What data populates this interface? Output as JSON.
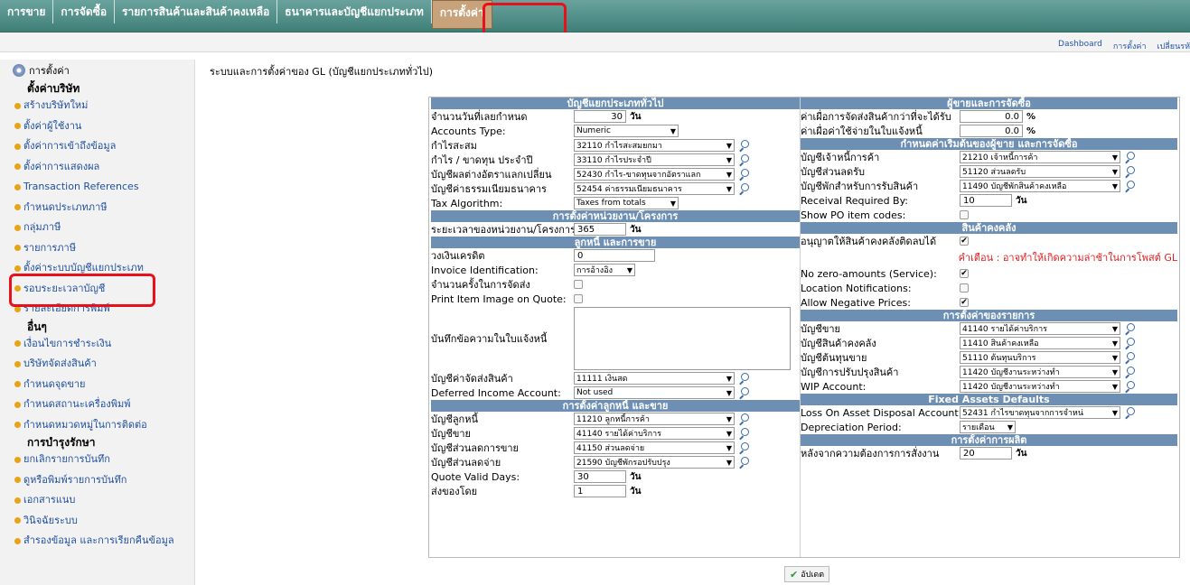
{
  "topnav": {
    "tabs": [
      "การขาย",
      "การจัดซื้อ",
      "รายการสินค้าและสินค้าคงเหลือ",
      "ธนาคารและบัญชีแยกประเภท",
      "การตั้งค่า"
    ],
    "links": [
      "Dashboard",
      "การตั้งค่า",
      "เปลี่ยนรหั"
    ]
  },
  "sidebar": {
    "header": "การตั้งค่า",
    "sections": [
      {
        "title": "ตั้งค่าบริษัท",
        "items": [
          "สร้างบริษัทใหม่",
          "ตั้งค่าผู้ใช้งาน",
          "ตั้งค่าการเข้าถึงข้อมูล",
          "ตั้งค่าการแสดงผล",
          "Transaction References",
          "กำหนดประเภทภาษี",
          "กลุ่มภาษี",
          "รายการภาษี",
          "ตั้งค่าระบบบัญชีแยกประเภท",
          "รอบระยะเวลาบัญชี",
          "รายละเอียดการพิมพ์"
        ]
      },
      {
        "title": "อื่นๆ",
        "items": [
          "เงื่อนไขการชำระเงิน",
          "บริษัทจัดส่งสินค้า",
          "กำหนดจุดขาย",
          "กำหนดสถานะเครื่องพิมพ์",
          "กำหนดหมวดหมู่ในการติดต่อ"
        ]
      },
      {
        "title": "การบำรุงรักษา",
        "items": [
          "ยกเลิกรายการบันทึก",
          "ดูหรือพิมพ์รายการบันทึก",
          "เอกสารแนบ",
          "วินิจฉัยระบบ",
          "สำรองข้อมูล และการเรียกคืนข้อมูล"
        ]
      }
    ]
  },
  "page": {
    "title": "ระบบและการตั้งค่าของ GL (บัญชีแยกประเภททั่วไป)",
    "update_label": "อัปเดต"
  },
  "left": {
    "gl": {
      "heading": "บัญชีแยกประเภททั่วไป",
      "rows": [
        {
          "label": "จำนวนวันที่เลยกำหนด",
          "value": "30",
          "unit": "วัน"
        },
        {
          "label": "Accounts Type:",
          "value": "Numeric"
        },
        {
          "label": "กำไรสะสม",
          "value": "32110   กำไรสะสมยกมา"
        },
        {
          "label": "กำไร / ขาดทุน ประจำปี",
          "value": "33110   กำไรประจำปี"
        },
        {
          "label": "บัญชีผลต่างอัตราแลกเปลี่ยน",
          "value": "52430   กำไร-ขาดทุนจากอัตราแลก"
        },
        {
          "label": "บัญชีค่าธรรมเนียมธนาคาร",
          "value": "52454   ค่าธรรมเนียมธนาคาร"
        },
        {
          "label": "Tax Algorithm:",
          "value": "Taxes from totals"
        }
      ]
    },
    "dim": {
      "heading": "การตั้งค่าหน่วยงาน/โครงการ",
      "label": "ระยะเวลาของหน่วยงาน/โครงการ",
      "value": "365",
      "unit": "วัน"
    },
    "cust": {
      "heading": "ลูกหนี้ และการขาย",
      "credit_label": "วงเงินเครดิต",
      "credit_value": "0",
      "invoice_label": "Invoice Identification:",
      "invoice_value": "การอ้างอิง",
      "ship_label": "จำนวนครั้งในการจัดส่ง",
      "print_label": "Print Item Image on Quote:",
      "memo_label": "บันทึกข้อความในใบแจ้งหนี้",
      "freight_label": "บัญชีค่าจัดส่งสินค้า",
      "freight_value": "11111   เงินสด",
      "deferred_label": "Deferred Income Account:",
      "deferred_value": "Not used"
    },
    "custdef": {
      "heading": "การตั้งค่าลูกหนี้ และขาย",
      "rows": [
        {
          "label": "บัญชีลูกหนี้",
          "value": "11210   ลูกหนี้การค้า"
        },
        {
          "label": "บัญชีขาย",
          "value": "41140   รายได้ค่าบริการ"
        },
        {
          "label": "บัญชีส่วนลดการขาย",
          "value": "41150   ส่วนลดจ่าย"
        },
        {
          "label": "บัญชีส่วนลดจ่าย",
          "value": "21590   บัญชีพักรอปรับปรุง"
        }
      ],
      "quote_label": "Quote Valid Days:",
      "quote_value": "30",
      "quote_unit": "วัน",
      "deliver_label": "ส่งของโดย",
      "deliver_value": "1",
      "deliver_unit": "วัน"
    }
  },
  "right": {
    "supp": {
      "heading": "ผู้ขายและการจัดซื้อ",
      "over_receive_label": "ค่าเผื่อการจัดส่งสินค้ากว่าที่จะได้รับ",
      "over_receive_value": "0.0",
      "over_charge_label": "ค่าเผื่อค่าใช้จ่ายในใบแจ้งหนี้",
      "over_charge_value": "0.0",
      "pct": "%"
    },
    "suppdef": {
      "heading": "กำหนดค่าเริ่มต้นของผู้ขาย และการจัดซื้อ",
      "rows": [
        {
          "label": "บัญชีเจ้าหนี้การค้า",
          "value": "21210   เจ้าหนี้การค้า"
        },
        {
          "label": "บัญชีส่วนลดรับ",
          "value": "51120   ส่วนลดรับ"
        },
        {
          "label": "บัญชีพักสำหรับการรับสินค้า",
          "value": "11490   บัญชีพักสินค้าคงเหลือ"
        }
      ],
      "recv_label": "Receival Required By:",
      "recv_value": "10",
      "recv_unit": "วัน",
      "po_label": "Show PO item codes:"
    },
    "inv": {
      "heading": "สินค้าคงคลัง",
      "allow_neg_label": "อนุญาตให้สินค้าคงคลังติดลบได้",
      "warning": "คำเตือน : อาจทำให้เกิดความล่าช้าในการโพสต์ GL",
      "zero_label": "No zero-amounts (Service):",
      "loc_label": "Location Notifications:",
      "neg_price_label": "Allow Negative Prices:"
    },
    "itemdef": {
      "heading": "การตั้งค่าของรายการ",
      "rows": [
        {
          "label": "บัญชีขาย",
          "value": "41140   รายได้ค่าบริการ"
        },
        {
          "label": "บัญชีสินค้าคงคลัง",
          "value": "11410   สินค้าคงเหลือ"
        },
        {
          "label": "บัญชีต้นทุนขาย",
          "value": "51110   ต้นทุนบริการ"
        },
        {
          "label": "บัญชีการปรับปรุงสินค้า",
          "value": "11420   บัญชีงานระหว่างทำ"
        },
        {
          "label": "WIP Account:",
          "value": "11420   บัญชีงานระหว่างทำ"
        }
      ]
    },
    "fa": {
      "heading": "Fixed Assets Defaults",
      "loss_label": "Loss On Asset Disposal Account:",
      "loss_value": "52431   กำไรขาดทุนจากการจำหน่",
      "dep_label": "Depreciation Period:",
      "dep_value": "รายเดือน"
    },
    "mfg": {
      "heading": "การตั้งค่าการผลิต",
      "label": "หลังจากความต้องการการสั่งงาน",
      "value": "20",
      "unit": "วัน"
    }
  }
}
